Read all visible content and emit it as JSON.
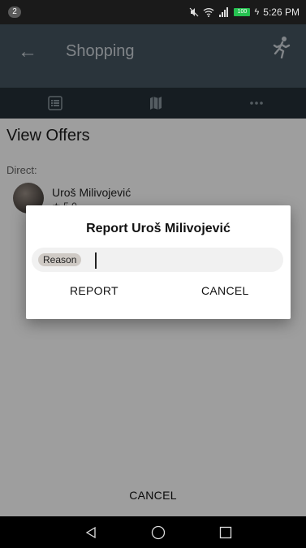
{
  "status_bar": {
    "notification_count": "2",
    "battery": "100",
    "time": "5:26 PM"
  },
  "app_bar": {
    "title": "Shopping",
    "back_icon": "arrow-left-icon",
    "action_icon": "runner-icon"
  },
  "tabs": [
    {
      "icon": "list-icon"
    },
    {
      "icon": "map-icon"
    },
    {
      "icon": "more-icon"
    }
  ],
  "content": {
    "title": "View Offers",
    "section_label": "Direct:",
    "offer": {
      "name": "Uroš Milivojević",
      "rating": "★ 5.0"
    },
    "bottom_cancel_label": "CANCEL"
  },
  "dialog": {
    "title": "Report Uroš Milivojević",
    "reason_chip": "Reason",
    "reason_value": "",
    "report_label": "REPORT",
    "cancel_label": "CANCEL"
  },
  "colors": {
    "app_bar": "#455560",
    "tab_bar": "#253038",
    "battery": "#26c251"
  }
}
